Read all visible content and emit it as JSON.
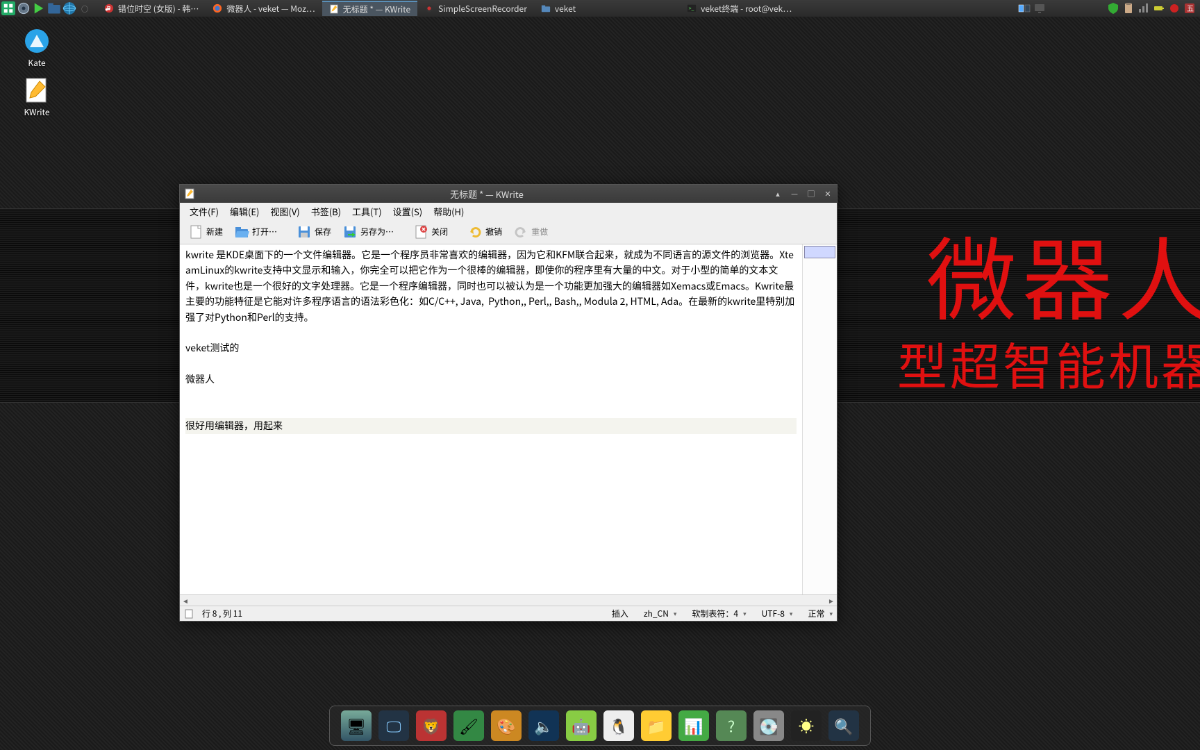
{
  "taskbar": {
    "tasks": [
      {
        "label": "错位时空 (女版) - 韩…",
        "icon": "music-icon"
      },
      {
        "label": "微器人 - veket — Moz…",
        "icon": "firefox-icon"
      },
      {
        "label": "无标题 * — KWrite",
        "icon": "kwrite-icon",
        "active": true
      },
      {
        "label": "SimpleScreenRecorder",
        "icon": "recorder-icon"
      },
      {
        "label": "veket",
        "icon": "folder-icon"
      },
      {
        "label": "veket终端 - root@vek…",
        "icon": "terminal-icon"
      }
    ]
  },
  "desktop_icons": [
    {
      "label": "Kate",
      "name": "kate-app"
    },
    {
      "label": "KWrite",
      "name": "kwrite-app"
    }
  ],
  "wallpaper": {
    "line1": "微器人",
    "line2": "型超智能机器"
  },
  "window": {
    "title": "无标题 * — KWrite",
    "menubar": [
      {
        "label": "文件(F)",
        "key": "F"
      },
      {
        "label": "编辑(E)",
        "key": "E"
      },
      {
        "label": "视图(V)",
        "key": "V"
      },
      {
        "label": "书签(B)",
        "key": "B"
      },
      {
        "label": "工具(T)",
        "key": "T"
      },
      {
        "label": "设置(S)",
        "key": "S"
      },
      {
        "label": "帮助(H)",
        "key": "H"
      }
    ],
    "toolbar": {
      "new": "新建",
      "open": "打开…",
      "save": "保存",
      "saveas": "另存为…",
      "close": "关闭",
      "undo": "撤销",
      "redo": "重做"
    },
    "content_lines": [
      "kwrite 是KDE桌面下的一个文件编辑器。它是一个程序员非常喜欢的编辑器，因为它和KFM联合起来，就成为不同语言的源文件的浏览器。XteamLinux的kwrite支持中文显示和输入，你完全可以把它作为一个很棒的编辑器，即使你的程序里有大量的中文。对于小型的简单的文本文件，kwrite也是一个很好的文字处理器。它是一个程序编辑器，同时也可以被认为是一个功能更加强大的编辑器如Xemacs或Emacs。Kwrite最主要的功能特征是它能对许多程序语言的语法彩色化：如C/C++, Java,  Python,, Perl,, Bash,, Modula 2, HTML, Ada。在最新的kwrite里特别加强了对Python和Perl的支持。",
      "",
      "veket测试的",
      "",
      "微器人",
      "",
      "",
      "很好用编辑器，用起来"
    ],
    "statusbar": {
      "position": "行 8 , 列 11",
      "insert": "插入",
      "locale": "zh_CN",
      "tabwidth_label": "软制表符：4",
      "encoding": "UTF-8",
      "mode": "正常"
    }
  },
  "dock_items": [
    "desktop",
    "monitor",
    "lion",
    "paint",
    "palette",
    "audio",
    "android",
    "penguin",
    "files",
    "office",
    "help",
    "disk",
    "brightness",
    "lens"
  ]
}
